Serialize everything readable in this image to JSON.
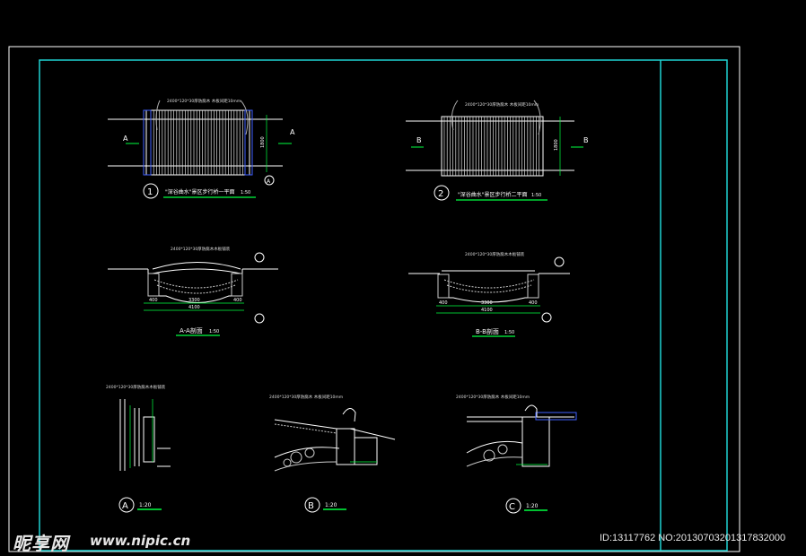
{
  "plans": {
    "plan1": {
      "number": "1",
      "title": "\"深谷曲水\"景区步行桥一平面",
      "scale": "1:50",
      "section_mark": "A",
      "note": "2400*120*30厚防腐木 木板间距10mm",
      "dim": "1800"
    },
    "plan2": {
      "number": "2",
      "title": "\"深谷曲水\"景区步行桥二平面",
      "scale": "1:50",
      "section_mark": "B",
      "note": "2400*120*30厚防腐木 木板间距10mm",
      "dim": "1800"
    }
  },
  "sections": {
    "aa": {
      "title": "A-A剖面",
      "scale": "1:50",
      "dims": [
        "3300",
        "400",
        "400",
        "4100"
      ],
      "note": "2400*120*30厚防腐木木板铺装"
    },
    "bb": {
      "title": "B-B剖面",
      "scale": "1:50",
      "dims": [
        "3300",
        "400",
        "400",
        "4100"
      ],
      "note": "2400*120*30厚防腐木木板铺装"
    }
  },
  "details": {
    "a": {
      "mark": "A",
      "scale": "1:20",
      "note": "2400*120*30厚防腐木木板铺装"
    },
    "b": {
      "mark": "B",
      "scale": "1:20",
      "note": "2400*120*30厚防腐木 木板间距10mm"
    },
    "c": {
      "mark": "C",
      "scale": "1:20",
      "note": "2400*120*30厚防腐木 木板间距10mm"
    }
  },
  "watermark": {
    "logo": "昵享网",
    "url": "www.nipic.cn",
    "id": "ID:13117762 NO:20130703201317832000"
  },
  "colors": {
    "frame": "#1fd3d3",
    "outer": "#ffffff",
    "dim": "#00ff40",
    "line": "#ffffff"
  }
}
